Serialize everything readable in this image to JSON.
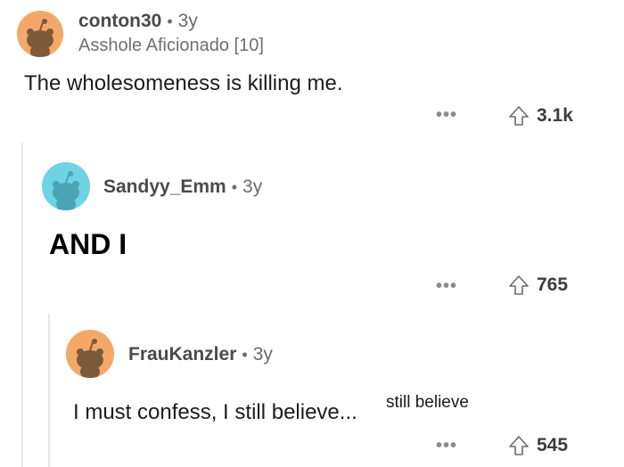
{
  "comments": [
    {
      "username": "conton30",
      "age": "3y",
      "flair": "Asshole Aficionado [10]",
      "body": "The wholesomeness is killing me.",
      "more": "•••",
      "votes": "3.1k",
      "avatar_color": "#F4A867"
    },
    {
      "username": "Sandyy_Emm",
      "age": "3y",
      "body": "AND I",
      "more": "•••",
      "votes": "765",
      "avatar_color": "#6ED3E3"
    },
    {
      "username": "FrauKanzler",
      "age": "3y",
      "body": "I must confess, I still believe...",
      "body_superscript": "still believe",
      "more": "•••",
      "votes": "545",
      "avatar_color": "#F4A867"
    }
  ],
  "separator": "•",
  "icons": {
    "upvote": "upvote-arrow-icon",
    "more": "more-options-icon",
    "avatar": "snoo-avatar-icon"
  }
}
